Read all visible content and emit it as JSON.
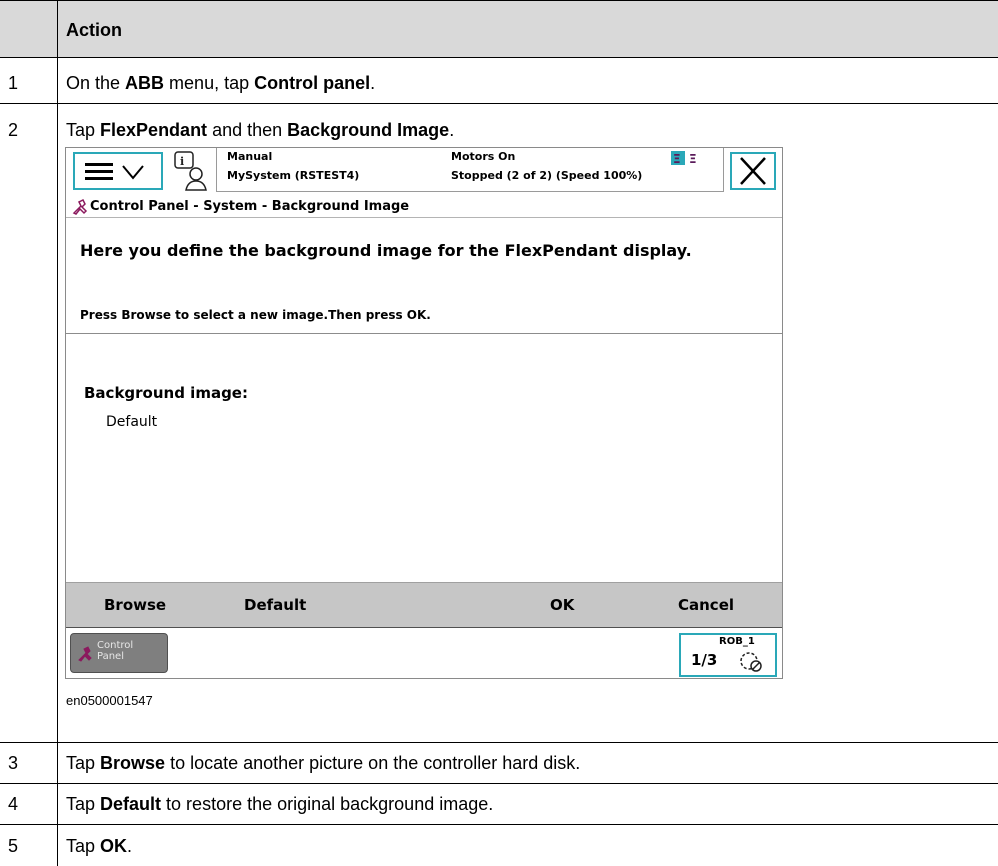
{
  "table": {
    "header": {
      "num": "",
      "action": "Action"
    },
    "rows": [
      {
        "num": "1",
        "parts": [
          "On the ",
          "ABB",
          " menu, tap ",
          "Control panel",
          "."
        ]
      },
      {
        "num": "2",
        "parts": [
          "Tap ",
          "FlexPendant",
          " and then ",
          "Background Image",
          "."
        ]
      },
      {
        "num": "3",
        "parts": [
          "Tap ",
          "Browse",
          " to locate another picture on the controller hard disk."
        ]
      },
      {
        "num": "4",
        "parts": [
          "Tap ",
          "Default",
          " to restore the original background image."
        ]
      },
      {
        "num": "5",
        "parts": [
          "Tap ",
          "OK",
          "."
        ]
      }
    ]
  },
  "figure_caption": "en0500001547",
  "pendant": {
    "status": {
      "mode": "Manual",
      "system": "MySystem (RSTEST4)",
      "motors": "Motors On",
      "state": "Stopped (2 of 2) (Speed 100%)"
    },
    "breadcrumb": "Control Panel - System - Background Image",
    "description": "Here you define the background image for the FlexPendant display.",
    "instruction": "Press Browse to select a new image.Then press OK.",
    "field_label": "Background image:",
    "field_value": "Default",
    "commands": {
      "browse": "Browse",
      "default": "Default",
      "ok": "OK",
      "cancel": "Cancel"
    },
    "taskbar": {
      "control_panel_line1": "Control",
      "control_panel_line2": "Panel",
      "rob_label": "ROB_1",
      "fraction": "1/3"
    },
    "accent_color": "#2aa8b8",
    "icons": [
      "abb-menu-icon",
      "info-event-icon",
      "close-icon",
      "robot-status-icon",
      "control-panel-icon",
      "quickset-icon"
    ]
  }
}
